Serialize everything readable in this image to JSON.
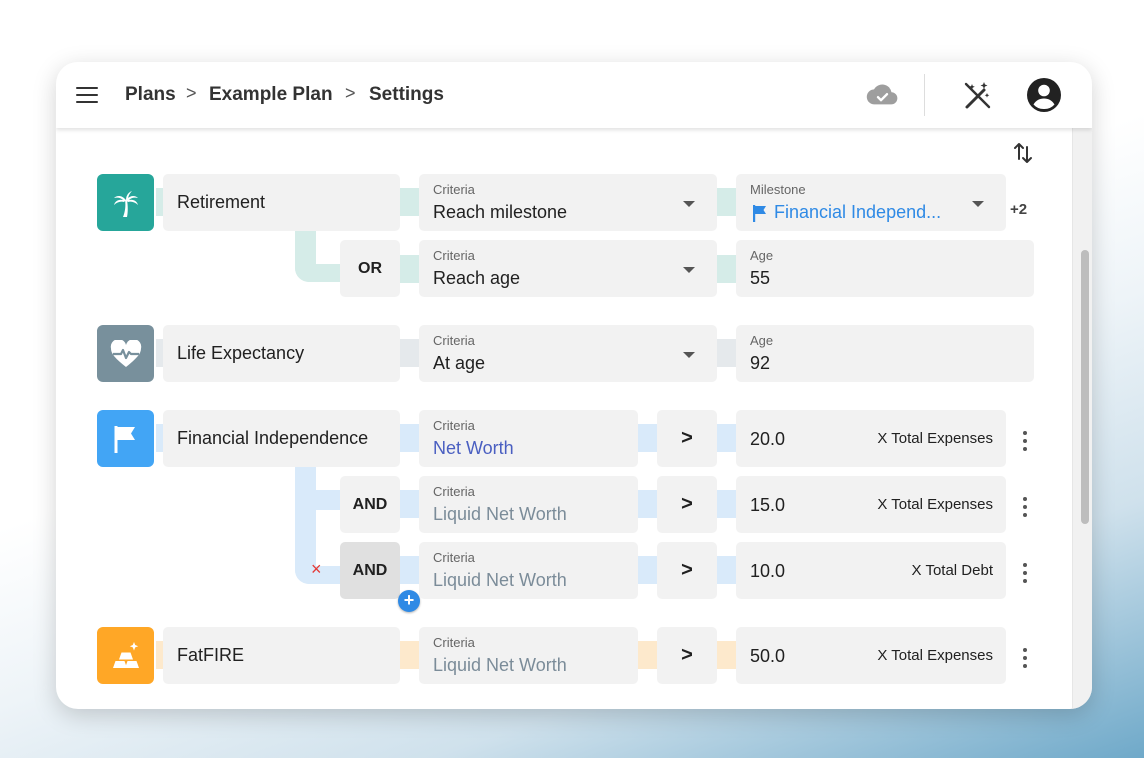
{
  "breadcrumb": [
    "Plans",
    "Example Plan",
    "Settings"
  ],
  "breadcrumb_separator": ">",
  "icons": {
    "menu": "menu-icon",
    "cloud": "cloud-done-icon",
    "wand": "auto-fix-off-icon",
    "account": "account-circle-icon",
    "sort": "swap-vert-icon"
  },
  "milestones": [
    {
      "name": "Retirement",
      "icon": "palm-tree-icon",
      "color": "#26a69a",
      "rows": [
        {
          "criteria_label": "Criteria",
          "criteria": "Reach milestone",
          "value_label": "Milestone",
          "value": "Financial Independ...",
          "extra": "+2"
        },
        {
          "conjunction": "OR",
          "criteria_label": "Criteria",
          "criteria": "Reach age",
          "value_label": "Age",
          "value": "55"
        }
      ]
    },
    {
      "name": "Life Expectancy",
      "icon": "heart-pulse-icon",
      "color": "#78909c",
      "rows": [
        {
          "criteria_label": "Criteria",
          "criteria": "At age",
          "value_label": "Age",
          "value": "92"
        }
      ]
    },
    {
      "name": "Financial Independence",
      "icon": "flag-icon",
      "color": "#42a5f5",
      "rows": [
        {
          "criteria_label": "Criteria",
          "criteria": "Net Worth",
          "operator": ">",
          "value": "20.0",
          "unit": "X Total Expenses"
        },
        {
          "conjunction": "AND",
          "criteria_label": "Criteria",
          "criteria": "Liquid Net Worth",
          "operator": ">",
          "value": "15.0",
          "unit": "X Total Expenses"
        },
        {
          "conjunction": "AND",
          "criteria_label": "Criteria",
          "criteria": "Liquid Net Worth",
          "operator": ">",
          "value": "10.0",
          "unit": "X Total Debt",
          "remove": "×",
          "add": "+"
        }
      ]
    },
    {
      "name": "FatFIRE",
      "icon": "gold-bars-icon",
      "color": "#ffa726",
      "rows": [
        {
          "criteria_label": "Criteria",
          "criteria": "Liquid Net Worth",
          "operator": ">",
          "value": "50.0",
          "unit": "X Total Expenses"
        }
      ]
    }
  ]
}
